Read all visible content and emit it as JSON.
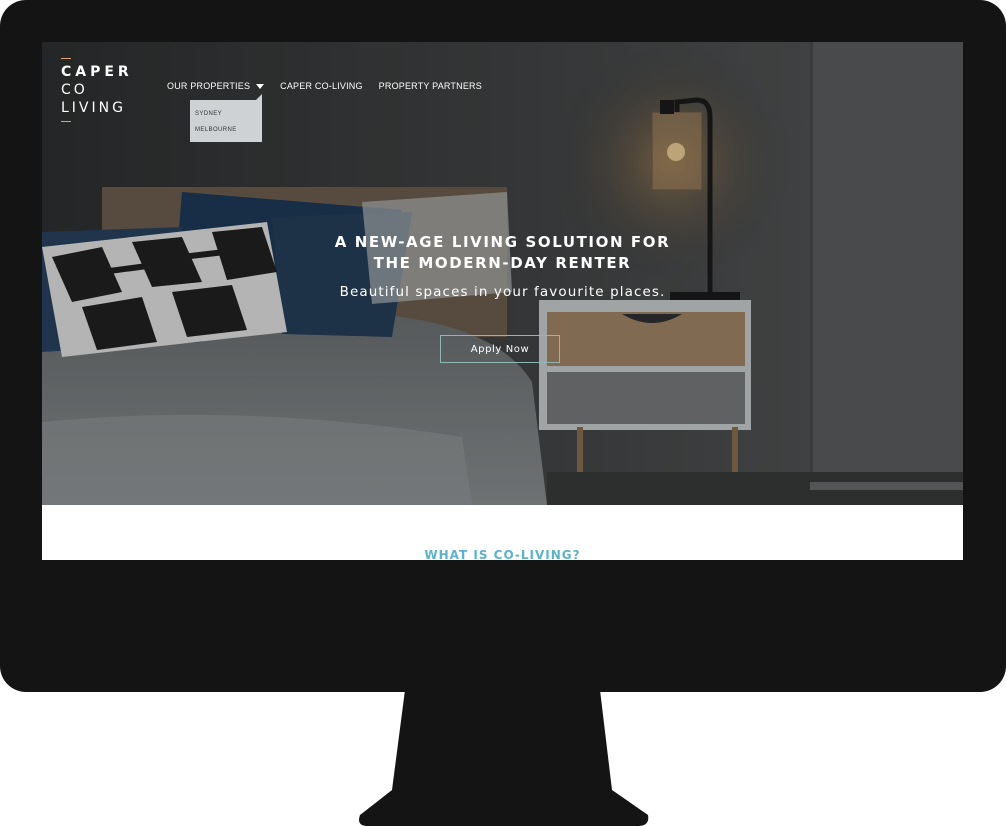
{
  "logo": {
    "line1": "CAPER",
    "line2": "CO",
    "line3": "LIVING"
  },
  "nav": {
    "items": [
      {
        "label": "OUR PROPERTIES"
      },
      {
        "label": "CAPER CO-LIVING"
      },
      {
        "label": "PROPERTY PARTNERS"
      }
    ],
    "dropdown": [
      "SYDNEY",
      "MELBOURNE"
    ]
  },
  "hero": {
    "headline_line1": "A NEW-AGE LIVING SOLUTION FOR",
    "headline_line2": "THE MODERN-DAY RENTER",
    "subheadline": "Beautiful spaces in your favourite places.",
    "cta_label": "Apply Now"
  },
  "section": {
    "title": "WHAT IS CO-LIVING?"
  },
  "colors": {
    "accent_teal": "#5bb2cc",
    "logo_accent": "#e1a07a",
    "monitor": "#141414"
  },
  "icons": {
    "dropdown_caret": "caret-down-icon"
  }
}
